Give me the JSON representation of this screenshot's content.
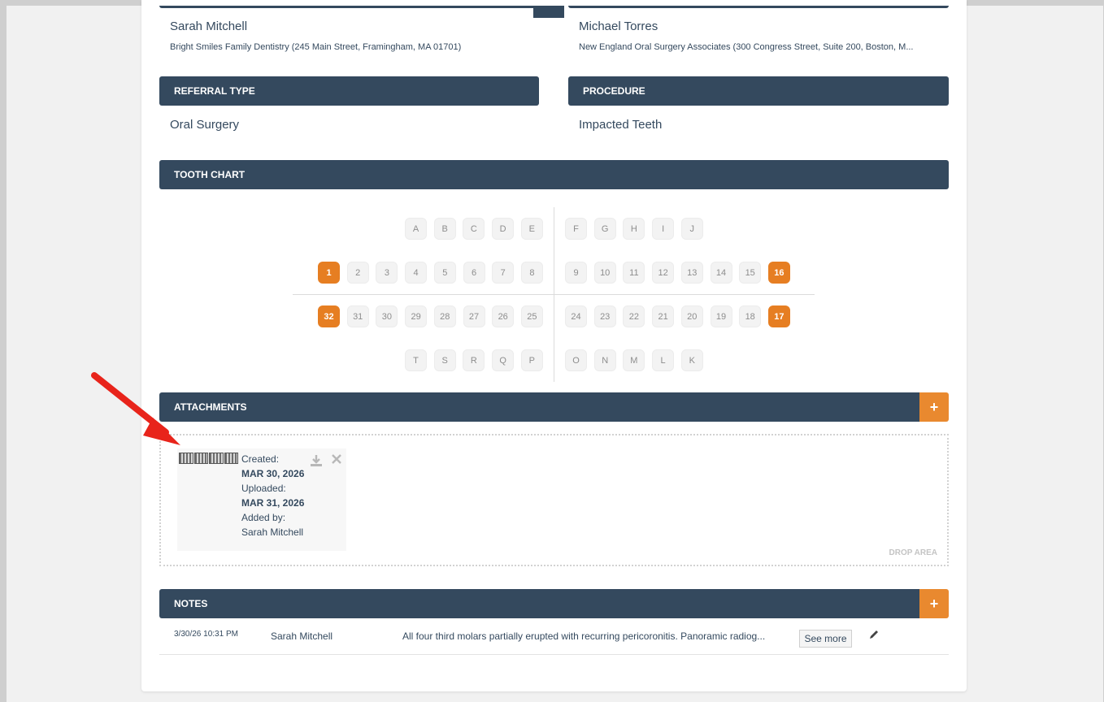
{
  "referral": {
    "referring_name": "Sarah Mitchell",
    "referring_practice": "Bright Smiles Family Dentistry (245 Main Street, Framingham, MA 01701)",
    "receiving_name": "Michael Torres",
    "receiving_practice": "New England Oral Surgery Associates (300 Congress Street, Suite 200, Boston, M..."
  },
  "referral_type": {
    "header": "REFERRAL TYPE",
    "value": "Oral Surgery"
  },
  "procedure": {
    "header": "PROCEDURE",
    "value": "Impacted Teeth"
  },
  "tooth_chart": {
    "header": "TOOTH CHART",
    "primary_upper_left": [
      "A",
      "B",
      "C",
      "D",
      "E"
    ],
    "primary_upper_right": [
      "F",
      "G",
      "H",
      "I",
      "J"
    ],
    "upper_left": [
      "1",
      "2",
      "3",
      "4",
      "5",
      "6",
      "7",
      "8"
    ],
    "upper_right": [
      "9",
      "10",
      "11",
      "12",
      "13",
      "14",
      "15",
      "16"
    ],
    "lower_left": [
      "32",
      "31",
      "30",
      "29",
      "28",
      "27",
      "26",
      "25"
    ],
    "lower_right": [
      "24",
      "23",
      "22",
      "21",
      "20",
      "19",
      "18",
      "17"
    ],
    "primary_lower_left": [
      "T",
      "S",
      "R",
      "Q",
      "P"
    ],
    "primary_lower_right": [
      "O",
      "N",
      "M",
      "L",
      "K"
    ],
    "selected": [
      "1",
      "16",
      "17",
      "32"
    ],
    "selected_color": "#e67e22"
  },
  "attachments": {
    "header": "ATTACHMENTS",
    "add_label": "+",
    "drop_label": "DROP AREA",
    "items": [
      {
        "created_label": "Created:",
        "created_date": "MAR 30, 2026",
        "uploaded_label": "Uploaded:",
        "uploaded_date": "MAR 31, 2026",
        "added_by_label": "Added by:",
        "added_by": "Sarah Mitchell",
        "download_icon": "download-icon",
        "remove_icon": "close-icon"
      }
    ]
  },
  "notes": {
    "header": "NOTES",
    "add_label": "+",
    "rows": [
      {
        "date": "3/30/26 10:31 PM",
        "author": "Sarah Mitchell",
        "text": "All four third molars partially erupted with recurring pericoronitis. Panoramic radiog...",
        "see_more": "See more",
        "edit_icon": "pencil-icon"
      }
    ]
  },
  "colors": {
    "header_bg": "#34495e",
    "accent": "#e9892f",
    "annotation_arrow": "#e8241b"
  }
}
